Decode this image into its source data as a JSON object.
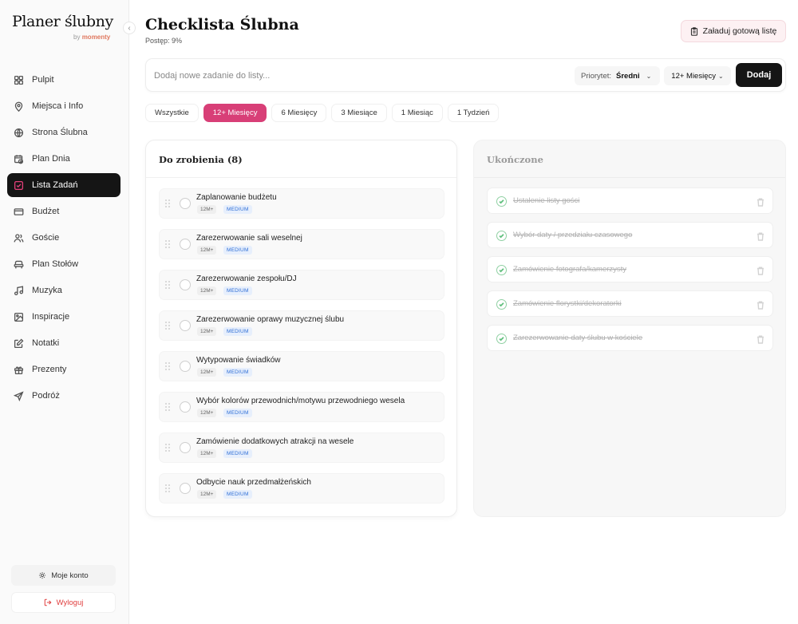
{
  "brand": {
    "title": "Planer ślubny",
    "by": "by",
    "partner": "momenty"
  },
  "sidebar": {
    "items": [
      {
        "label": "Pulpit",
        "icon": "grid-icon"
      },
      {
        "label": "Miejsca i Info",
        "icon": "map-pin-icon"
      },
      {
        "label": "Strona Ślubna",
        "icon": "globe-icon"
      },
      {
        "label": "Plan Dnia",
        "icon": "calendar-clock-icon"
      },
      {
        "label": "Lista Zadań",
        "icon": "checkbox-icon",
        "active": true
      },
      {
        "label": "Budżet",
        "icon": "wallet-icon"
      },
      {
        "label": "Goście",
        "icon": "users-icon"
      },
      {
        "label": "Plan Stołów",
        "icon": "table-icon"
      },
      {
        "label": "Muzyka",
        "icon": "music-icon"
      },
      {
        "label": "Inspiracje",
        "icon": "image-icon"
      },
      {
        "label": "Notatki",
        "icon": "note-icon"
      },
      {
        "label": "Prezenty",
        "icon": "gift-icon"
      },
      {
        "label": "Podróż",
        "icon": "plane-icon"
      }
    ],
    "account_label": "Moje konto",
    "logout_label": "Wyloguj"
  },
  "header": {
    "title": "Checklista Ślubna",
    "progress": "Postęp: 9%",
    "progress_value": 9,
    "load_button": "Załaduj gotową listę"
  },
  "composer": {
    "placeholder": "Dodaj nowe zadanie do listy...",
    "value": "",
    "priority_label": "Priorytet:",
    "priority_value": "Średni",
    "time_value": "12+ Miesięcy",
    "add_label": "Dodaj"
  },
  "filters": [
    {
      "label": "Wszystkie"
    },
    {
      "label": "12+ Miesięcy",
      "active": true
    },
    {
      "label": "6 Miesięcy"
    },
    {
      "label": "3 Miesiące"
    },
    {
      "label": "1 Miesiąc"
    },
    {
      "label": "1 Tydzień"
    }
  ],
  "todo": {
    "title": "Do zrobienia (8)",
    "tasks": [
      {
        "name": "Zaplanowanie budżetu",
        "time": "12M+",
        "priority": "MEDIUM"
      },
      {
        "name": "Zarezerwowanie sali weselnej",
        "time": "12M+",
        "priority": "MEDIUM"
      },
      {
        "name": "Zarezerwowanie zespołu/DJ",
        "time": "12M+",
        "priority": "MEDIUM"
      },
      {
        "name": "Zarezerwowanie oprawy muzycznej ślubu",
        "time": "12M+",
        "priority": "MEDIUM"
      },
      {
        "name": "Wytypowanie świadków",
        "time": "12M+",
        "priority": "MEDIUM"
      },
      {
        "name": "Wybór kolorów przewodnich/motywu przewodniego wesela",
        "time": "12M+",
        "priority": "MEDIUM"
      },
      {
        "name": "Zamówienie dodatkowych atrakcji na wesele",
        "time": "12M+",
        "priority": "MEDIUM"
      },
      {
        "name": "Odbycie nauk przedmałżeńskich",
        "time": "12M+",
        "priority": "MEDIUM"
      }
    ]
  },
  "done": {
    "title": "Ukończone",
    "tasks": [
      {
        "name": "Ustalenie listy gości"
      },
      {
        "name": "Wybór daty / przedziału czasowego"
      },
      {
        "name": "Zamówienie fotografa/kamerzysty"
      },
      {
        "name": "Zamówienie florystki/dekoratorki"
      },
      {
        "name": "Zarezerwowanie daty ślubu w kościele"
      }
    ]
  },
  "colors": {
    "accent": "#d83f77",
    "dark": "#151515",
    "success": "#5fbf7c",
    "priority_badge": "#2f6fd6"
  }
}
